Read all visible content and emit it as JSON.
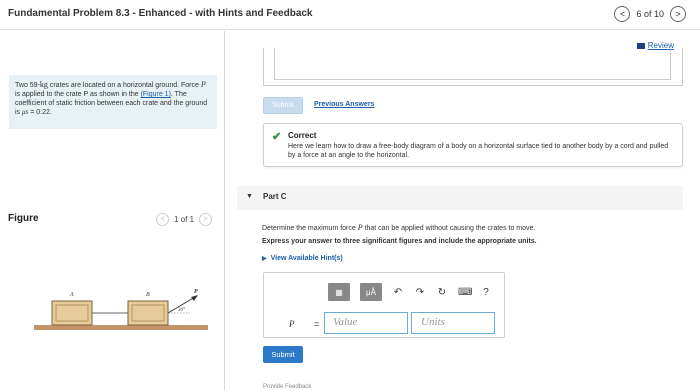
{
  "header": {
    "title": "Fundamental Problem 8.3 - Enhanced - with Hints and Feedback",
    "prev_label": "<",
    "next_label": ">",
    "page_indicator": "6 of 10"
  },
  "problem": {
    "text_part1": "Two 59-",
    "mass_unit": "kg",
    "text_part2": " crates are located on a horizontal ground. Force ",
    "force_var": "P",
    "text_part3": " is applied to the crate P as shown in the ",
    "link_text": "(Figure 1)",
    "text_part4": ". The coefficient of static friction between each crate and the ground is ",
    "mu_symbol": "μs",
    "text_part5": " = 0.22."
  },
  "figure": {
    "label": "Figure",
    "pager": "1 of 1",
    "prev": "<",
    "next": ">",
    "crate_a": "A",
    "crate_b": "B",
    "force_label": "P",
    "angle_label": "30°"
  },
  "review": {
    "label": "Review"
  },
  "prev_part": {
    "submit_label": "Submit",
    "previous_answers": "Previous Answers"
  },
  "feedback": {
    "title": "Correct",
    "message": "Here we learn how to draw a free-body diagram of a body on a horizontal surface tied to another body by a cord and pulled by a force at an angle to the horizontal."
  },
  "part_c": {
    "label": "Part C",
    "question_pre": "Determine the maximum force ",
    "question_var": "P",
    "question_post": " that can be applied without causing the crates to move.",
    "instructions": "Express your answer to three significant figures and include the appropriate units.",
    "hint": "View Available Hint(s)",
    "variable": "P",
    "equals": "=",
    "value_placeholder": "Value",
    "units_placeholder": "Units",
    "submit_label": "Submit"
  },
  "toolbar": {
    "templates_icon": "▦",
    "units_icon": "μÅ",
    "undo_icon": "↶",
    "redo_icon": "↷",
    "reset_icon": "↻",
    "keyboard_icon": "⌨",
    "help_icon": "?"
  },
  "footer": {
    "text": "Provide Feedback"
  },
  "colors": {
    "accent": "#2b79c8",
    "link": "#1a5fa8",
    "problem_bg": "#e8f1f5",
    "correct": "#2e8a3a"
  }
}
